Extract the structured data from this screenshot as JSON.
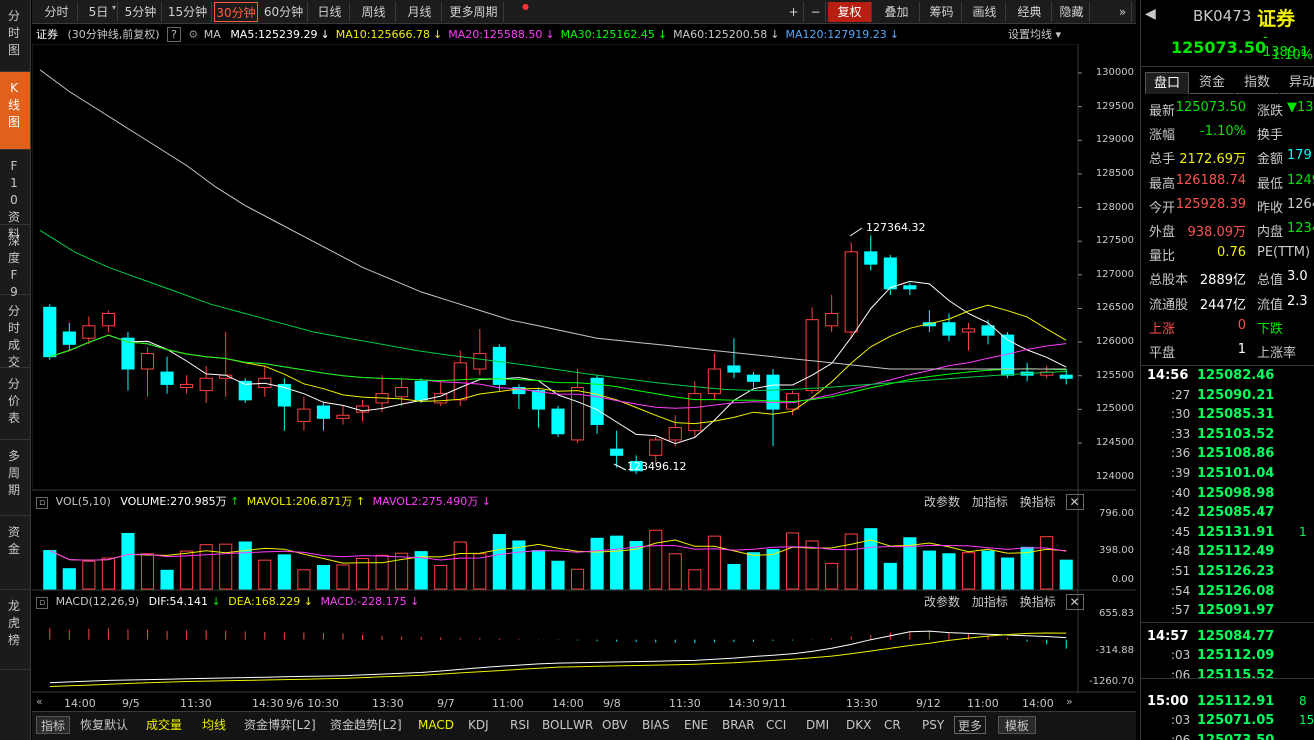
{
  "sidebar": [
    "分时图",
    "K线图",
    "F10资料",
    "深度F9",
    "分时成交",
    "分价表",
    "多周期",
    "资金",
    "龙虎榜"
  ],
  "toolbar": {
    "periods": [
      "分时",
      "5日",
      "5分钟",
      "15分钟",
      "30分钟",
      "60分钟",
      "日线",
      "周线",
      "月线",
      "更多周期"
    ],
    "right": [
      "+",
      "−",
      "复权",
      "叠加",
      "筹码",
      "画线",
      "经典",
      "隐藏"
    ]
  },
  "header": {
    "name": "证券",
    "mode": "(30分钟线,前复权)",
    "help": "?",
    "ma_label": "MA",
    "ma": [
      {
        "t": "MA5:125239.29",
        "c": "#ffffff"
      },
      {
        "t": "MA10:125666.78",
        "c": "#f0f000"
      },
      {
        "t": "MA20:125588.50",
        "c": "#ff3cff"
      },
      {
        "t": "MA30:125162.45",
        "c": "#00ff00"
      },
      {
        "t": "MA60:125200.58",
        "c": "#c8c8c8"
      },
      {
        "t": "MA120:127919.23",
        "c": "#55aaff"
      }
    ],
    "setting": "设置均线"
  },
  "price_axis": [
    "130000",
    "129500",
    "129000",
    "128500",
    "128000",
    "127500",
    "127000",
    "126500",
    "126000",
    "125500",
    "125000",
    "124500",
    "124000"
  ],
  "annotations": {
    "high": "127364.32",
    "low": "123496.12"
  },
  "vol": {
    "label": "VOL(5,10)",
    "volume": "VOLUME:270.985万",
    "m1": "MAVOL1:206.871万",
    "m2": "MAVOL2:275.490万",
    "axis": [
      "796.00",
      "398.00",
      "0.00"
    ],
    "actions": [
      "改参数",
      "加指标",
      "换指标"
    ]
  },
  "macd": {
    "label": "MACD(12,26,9)",
    "dif": "DIF:54.141",
    "dea": "DEA:168.229",
    "macd": "MACD:-228.175",
    "axis": [
      "655.83",
      "-314.88",
      "-1260.70"
    ],
    "actions": [
      "改参数",
      "加指标",
      "换指标"
    ]
  },
  "xaxis": [
    "14:00",
    "9/5",
    "11:30",
    "14:30",
    "9/6 10:30",
    "13:30",
    "9/7",
    "11:00",
    "14:00",
    "9/8",
    "11:30",
    "14:30",
    "9/11",
    "13:30",
    "9/12",
    "11:00",
    "14:00"
  ],
  "bottom_tabs": [
    "指标",
    "恢复默认",
    "成交量",
    "均线",
    "资金博弈[L2]",
    "资金趋势[L2]",
    "MACD",
    "KDJ",
    "RSI",
    "BOLL",
    "WR",
    "OBV",
    "BIAS",
    "ENE",
    "BRAR",
    "CCI",
    "DMI",
    "DKX",
    "CR",
    "PSY",
    "更多",
    "模板"
  ],
  "quote": {
    "code": "BK0473",
    "name": "证券",
    "price": "125073.50",
    "change": "- 1389.1",
    "change_pct": "- 1.10%",
    "tabs": [
      "盘口",
      "资金",
      "指数",
      "异动"
    ],
    "rows": [
      {
        "k": "最新",
        "v": "125073.50",
        "vc": "#00e600",
        "k2": "涨跌",
        "v2": "▼13",
        "v2c": "#00e600"
      },
      {
        "k": "涨幅",
        "v": "-1.10%",
        "vc": "#00e600",
        "k2": "换手",
        "v2": "",
        "v2c": "#c8c8c8"
      },
      {
        "k": "总手",
        "v": "2172.69万",
        "vc": "#f0f000",
        "k2": "金额",
        "v2": "179",
        "v2c": "#00ffff"
      },
      {
        "k": "最高",
        "v": "126188.74",
        "vc": "#ff5050",
        "k2": "最低",
        "v2": "1249",
        "v2c": "#00e600"
      },
      {
        "k": "今开",
        "v": "125928.39",
        "vc": "#ff5050",
        "k2": "昨收",
        "v2": "1264",
        "v2c": "#c8c8c8"
      },
      {
        "k": "外盘",
        "v": "938.09万",
        "vc": "#ff5050",
        "k2": "内盘",
        "v2": "1234",
        "v2c": "#00e600"
      },
      {
        "k": "量比",
        "v": "0.76",
        "vc": "#f0f000",
        "k2": "PE(TTM)",
        "v2": "",
        "v2c": "#c8c8c8"
      },
      {
        "k": "总股本",
        "v": "2889亿",
        "vc": "#ffffff",
        "k2": "总值",
        "v2": "3.0",
        "v2c": "#ffffff"
      },
      {
        "k": "流通股",
        "v": "2447亿",
        "vc": "#ffffff",
        "k2": "流值",
        "v2": "2.3",
        "v2c": "#ffffff"
      },
      {
        "k": "上涨",
        "v": "0",
        "vc": "#ff5050",
        "k2": "下跌",
        "v2": "",
        "v2c": "#00e600"
      },
      {
        "k": "平盘",
        "v": "1",
        "vc": "#ffffff",
        "k2": "上涨率",
        "v2": "",
        "v2c": "#c8c8c8"
      }
    ],
    "ticks": [
      {
        "t": "14:56",
        "p": "125082.46",
        "s": ""
      },
      {
        "t": ":27",
        "p": "125090.21",
        "s": ""
      },
      {
        "t": ":30",
        "p": "125085.31",
        "s": ""
      },
      {
        "t": ":33",
        "p": "125103.52",
        "s": ""
      },
      {
        "t": ":36",
        "p": "125108.86",
        "s": ""
      },
      {
        "t": ":39",
        "p": "125101.04",
        "s": ""
      },
      {
        "t": ":40",
        "p": "125098.98",
        "s": ""
      },
      {
        "t": ":42",
        "p": "125085.47",
        "s": ""
      },
      {
        "t": ":45",
        "p": "125131.91",
        "s": "1"
      },
      {
        "t": ":48",
        "p": "125112.49",
        "s": ""
      },
      {
        "t": ":51",
        "p": "125126.23",
        "s": ""
      },
      {
        "t": ":54",
        "p": "125126.08",
        "s": ""
      },
      {
        "t": ":57",
        "p": "125091.97",
        "s": ""
      },
      {
        "t": "14:57",
        "p": "125084.77",
        "s": ""
      },
      {
        "t": ":03",
        "p": "125112.09",
        "s": ""
      },
      {
        "t": ":06",
        "p": "125115.52",
        "s": ""
      },
      {
        "t": "15:00",
        "p": "125112.91",
        "s": "8"
      },
      {
        "t": ":03",
        "p": "125071.05",
        "s": "15"
      },
      {
        "t": ":06",
        "p": "125073.50",
        "s": ""
      }
    ]
  },
  "chart_data": {
    "type": "candlestick",
    "title": "证券 (30分钟线,前复权)",
    "ylim": [
      123300,
      130200
    ],
    "candles": [
      [
        126200,
        125400,
        126250,
        125350
      ],
      [
        125800,
        125600,
        125950,
        125500
      ],
      [
        125700,
        125900,
        126050,
        125600
      ],
      [
        125900,
        126100,
        126150,
        125800
      ],
      [
        125700,
        125200,
        125800,
        124850
      ],
      [
        125200,
        125450,
        125550,
        124750
      ],
      [
        125150,
        124950,
        125400,
        124800
      ],
      [
        124900,
        124950,
        125100,
        124800
      ],
      [
        124850,
        125050,
        125250,
        124650
      ],
      [
        125050,
        125100,
        125800,
        124750
      ],
      [
        125000,
        124700,
        125050,
        124650
      ],
      [
        124900,
        125050,
        125250,
        124750
      ],
      [
        124950,
        124600,
        125050,
        124200
      ],
      [
        124350,
        124550,
        124750,
        124200
      ],
      [
        124600,
        124400,
        124650,
        124200
      ],
      [
        124400,
        124450,
        124600,
        124300
      ],
      [
        124500,
        124600,
        124700,
        124350
      ],
      [
        124650,
        124800,
        125100,
        124500
      ],
      [
        124750,
        124900,
        125050,
        124600
      ],
      [
        125000,
        124700,
        125050,
        124650
      ],
      [
        124650,
        124800,
        125000,
        124600
      ],
      [
        124700,
        125300,
        125500,
        124600
      ],
      [
        125200,
        125450,
        125850,
        125100
      ],
      [
        125550,
        124950,
        125600,
        124850
      ],
      [
        124900,
        124800,
        124950,
        124550
      ],
      [
        124850,
        124550,
        124900,
        124250
      ],
      [
        124550,
        124150,
        124600,
        124100
      ],
      [
        124050,
        124900,
        125200,
        124000
      ],
      [
        125050,
        124300,
        125100,
        124150
      ],
      [
        123900,
        123800,
        124200,
        123600
      ],
      [
        123700,
        123550,
        123800,
        123500
      ],
      [
        123800,
        124050,
        124100,
        123650
      ],
      [
        124050,
        124250,
        124450,
        123950
      ],
      [
        124200,
        124800,
        125000,
        124100
      ],
      [
        124800,
        125200,
        125450,
        124700
      ],
      [
        125250,
        125150,
        125700,
        125050
      ],
      [
        125100,
        125000,
        125150,
        124900
      ],
      [
        125100,
        124550,
        125200,
        123950
      ],
      [
        124550,
        124800,
        124850,
        124450
      ],
      [
        124850,
        126000,
        126200,
        124800
      ],
      [
        125900,
        126100,
        126400,
        125800
      ],
      [
        125800,
        127100,
        127250,
        125700
      ],
      [
        127100,
        126900,
        127364,
        126800
      ],
      [
        127000,
        126500,
        127050,
        126400
      ],
      [
        126550,
        126500,
        126600,
        126400
      ],
      [
        125950,
        125900,
        126150,
        125800
      ],
      [
        125950,
        125750,
        126100,
        125650
      ],
      [
        125800,
        125850,
        125950,
        125500
      ],
      [
        125900,
        125750,
        126000,
        125600
      ],
      [
        125750,
        125100,
        125800,
        125050
      ],
      [
        125150,
        125100,
        125300,
        125000
      ],
      [
        125100,
        125150,
        125250,
        125050
      ],
      [
        125100,
        125050,
        125200,
        124950
      ]
    ],
    "volume": [
      360,
      190,
      260,
      290,
      520,
      330,
      175,
      355,
      415,
      420,
      440,
      270,
      320,
      180,
      220,
      225,
      285,
      315,
      335,
      350,
      220,
      440,
      330,
      510,
      450,
      360,
      260,
      185,
      475,
      495,
      445,
      550,
      330,
      180,
      495,
      230,
      340,
      370,
      525,
      450,
      240,
      515,
      565,
      240,
      480,
      355,
      330,
      340,
      355,
      290,
      390,
      490,
      270
    ],
    "volume_ylim": [
      0,
      796
    ],
    "macd_bars": [
      300,
      250,
      280,
      290,
      270,
      260,
      220,
      240,
      250,
      230,
      210,
      200,
      190,
      180,
      170,
      160,
      120,
      100,
      80,
      70,
      60,
      50,
      40,
      30,
      20,
      10,
      -10,
      -20,
      -40,
      -50,
      -60,
      -70,
      -80,
      -90,
      -70,
      -60,
      -50,
      -30,
      -20,
      10,
      40,
      80,
      120,
      180,
      220,
      230,
      200,
      150,
      100,
      50,
      -50,
      -120,
      -228
    ],
    "dif": [
      -1100,
      -1080,
      -1060,
      -1040,
      -1030,
      -1020,
      -1010,
      -1000,
      -990,
      -980,
      -970,
      -960,
      -950,
      -940,
      -930,
      -920,
      -900,
      -880,
      -860,
      -840,
      -800,
      -760,
      -720,
      -680,
      -650,
      -620,
      -600,
      -590,
      -580,
      -570,
      -560,
      -550,
      -540,
      -530,
      -500,
      -470,
      -430,
      -400,
      -360,
      -300,
      -220,
      -120,
      0,
      100,
      200,
      220,
      180,
      160,
      140,
      120,
      100,
      80,
      54
    ],
    "dea": [
      -1200,
      -1180,
      -1160,
      -1140,
      -1120,
      -1100,
      -1085,
      -1070,
      -1060,
      -1050,
      -1040,
      -1030,
      -1020,
      -1010,
      -1000,
      -990,
      -970,
      -950,
      -930,
      -910,
      -880,
      -850,
      -820,
      -790,
      -760,
      -730,
      -700,
      -690,
      -680,
      -670,
      -660,
      -650,
      -640,
      -630,
      -610,
      -590,
      -560,
      -530,
      -500,
      -460,
      -420,
      -360,
      -290,
      -220,
      -150,
      -90,
      -20,
      40,
      90,
      130,
      160,
      170,
      168
    ],
    "macd_ylim": [
      -1260.7,
      655.83
    ],
    "ma_series": [
      {
        "name": "MA5",
        "color": "#ffffff"
      },
      {
        "name": "MA10",
        "color": "#f0f000"
      },
      {
        "name": "MA20",
        "color": "#ff3cff"
      },
      {
        "name": "MA30",
        "color": "#00ff00"
      },
      {
        "name": "MA60",
        "color": "#c8c8c8"
      }
    ]
  }
}
